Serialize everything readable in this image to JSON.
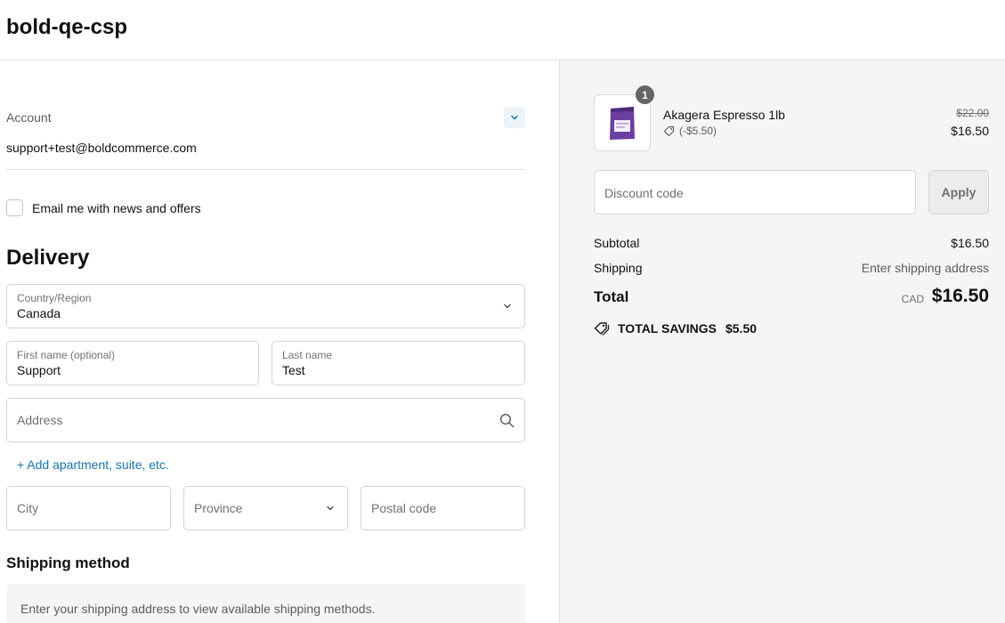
{
  "header": {
    "store_name": "bold-qe-csp"
  },
  "account": {
    "label": "Account",
    "email": "support+test@boldcommerce.com",
    "toggle_icon": "chevron-down-icon"
  },
  "newsletter": {
    "label": "Email me with news and offers",
    "checked": false
  },
  "delivery": {
    "heading": "Delivery",
    "country": {
      "label": "Country/Region",
      "value": "Canada"
    },
    "first_name": {
      "label": "First name (optional)",
      "value": "Support"
    },
    "last_name": {
      "label": "Last name",
      "value": "Test"
    },
    "address": {
      "placeholder": "Address",
      "icon": "search-icon"
    },
    "add_apartment": "+ Add apartment, suite, etc.",
    "city": {
      "placeholder": "City"
    },
    "province": {
      "placeholder": "Province"
    },
    "postal_code": {
      "placeholder": "Postal code"
    }
  },
  "shipping_method": {
    "heading": "Shipping method",
    "notice": "Enter your shipping address to view available shipping methods."
  },
  "order_summary": {
    "product": {
      "name": "Akagera Espresso 1lb",
      "quantity": "1",
      "discount": "(-$5.50)",
      "original_price": "$22.00",
      "final_price": "$16.50"
    },
    "discount_code": {
      "placeholder": "Discount code",
      "apply_label": "Apply"
    },
    "subtotal": {
      "label": "Subtotal",
      "value": "$16.50"
    },
    "shipping": {
      "label": "Shipping",
      "value": "Enter shipping address"
    },
    "total": {
      "label": "Total",
      "currency": "CAD",
      "value": "$16.50"
    },
    "savings": {
      "label": "TOTAL SAVINGS",
      "value": "$5.50"
    }
  },
  "colors": {
    "link": "#1773b0",
    "sidebar_bg": "#f5f5f5",
    "badge": "#666666",
    "product_package": "#6a3fa0"
  }
}
